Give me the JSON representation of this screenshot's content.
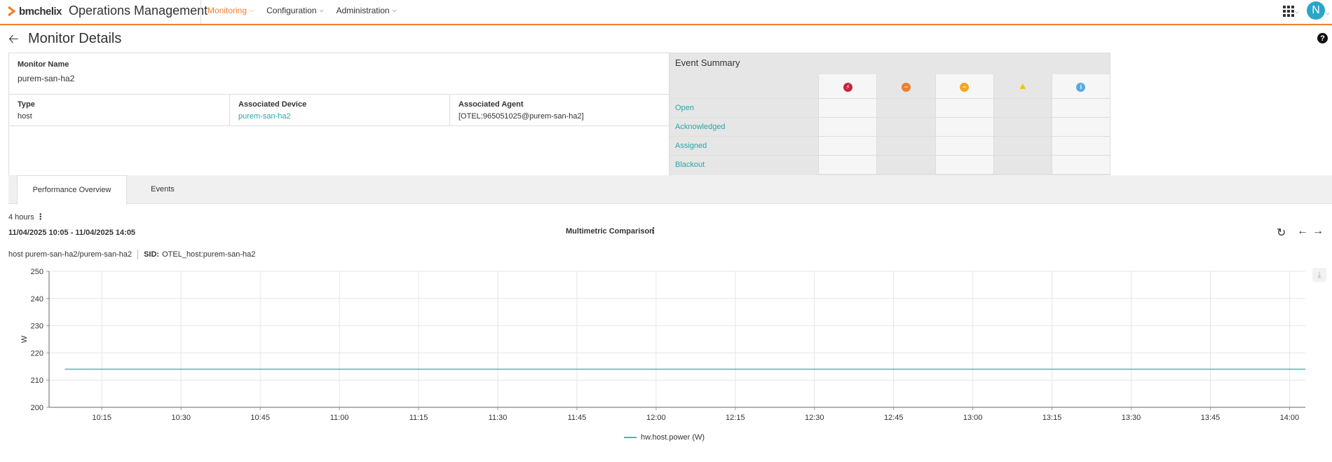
{
  "header": {
    "logo_bmc": "bmc",
    "logo_helix": "helix",
    "app_title": "Operations Management",
    "nav": [
      {
        "label": "Monitoring",
        "active": true
      },
      {
        "label": "Configuration",
        "active": false
      },
      {
        "label": "Administration",
        "active": false
      }
    ],
    "avatar_initial": "N",
    "apps_icon": "grid-icon"
  },
  "page": {
    "title": "Monitor Details",
    "back_icon": "arrow-left-icon",
    "help_icon": "help-icon"
  },
  "details": {
    "monitor_name_label": "Monitor Name",
    "monitor_name": "purem-san-ha2",
    "type_label": "Type",
    "type": "host",
    "device_label": "Associated Device",
    "device": "purem-san-ha2",
    "agent_label": "Associated Agent",
    "agent": "[OTEL:965051025@purem-san-ha2]"
  },
  "event_summary": {
    "title": "Event Summary",
    "severities": [
      {
        "name": "critical",
        "icon": "critical-icon",
        "color": "#c8243b"
      },
      {
        "name": "major",
        "icon": "major-icon",
        "color": "#f07f2c"
      },
      {
        "name": "minor",
        "icon": "minor-icon",
        "color": "#f5a623"
      },
      {
        "name": "warning",
        "icon": "warning-icon",
        "color": "#f5c400"
      },
      {
        "name": "info",
        "icon": "info-icon",
        "color": "#5aa9e6"
      }
    ],
    "rows": [
      "Open",
      "Acknowledged",
      "Assigned",
      "Blackout"
    ]
  },
  "tabs": [
    {
      "label": "Performance Overview",
      "active": true
    },
    {
      "label": "Events",
      "active": false
    }
  ],
  "toolbar": {
    "range_label": "4 hours",
    "range_dates": "11/04/2025 10:05 - 11/04/2025 14:05",
    "chart_title": "Multimetric Comparison",
    "host_text": "host purem-san-ha2/purem-san-ha2",
    "sid_label": "SID:",
    "sid_value": "OTEL_host:purem-san-ha2"
  },
  "colors": {
    "accent": "#f07f2c",
    "link": "#2aa6a6",
    "series": "#3cbfae"
  },
  "chart_data": {
    "type": "line",
    "ylabel": "W",
    "ylim": [
      200,
      250
    ],
    "yticks": [
      200,
      210,
      220,
      230,
      240,
      250
    ],
    "xticks": [
      "10:15",
      "10:30",
      "10:45",
      "11:00",
      "11:15",
      "11:30",
      "11:45",
      "12:00",
      "12:15",
      "12:30",
      "12:45",
      "13:00",
      "13:15",
      "13:30",
      "13:45",
      "14:00"
    ],
    "x_start": "10:05",
    "x_end": "14:03",
    "grid": true,
    "legend": "bottom",
    "series": [
      {
        "name": "hw.host.power (W)",
        "color": "#3cbfae",
        "x": [
          "10:08",
          "14:03"
        ],
        "values": [
          214,
          214
        ]
      }
    ]
  }
}
